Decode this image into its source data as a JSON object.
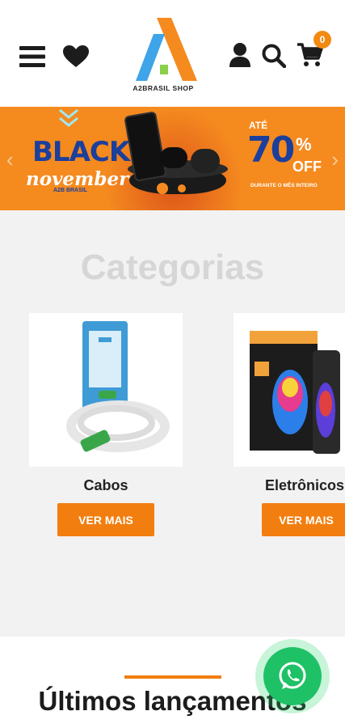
{
  "header": {
    "logo_text": "A2BRASIL SHOP",
    "cart_count": "0"
  },
  "banner": {
    "black": "BLACK",
    "november": "november",
    "brand": "A2B BRASIL",
    "ate": "ATÉ",
    "percent": "70",
    "percent_sign": "%",
    "off": "OFF",
    "durante": "DURANTE O MÊS INTEIRO"
  },
  "categories": {
    "title": "Categorias",
    "items": [
      {
        "label": "Cabos",
        "button": "VER MAIS"
      },
      {
        "label": "Eletrônicos",
        "button": "VER MAIS"
      }
    ]
  },
  "latest": {
    "title": "Últimos lançamentos"
  },
  "colors": {
    "accent": "#f27e0f",
    "banner_bg": "#f58a1f",
    "brand_blue": "#1b3f9c",
    "whatsapp": "#1fc166"
  },
  "icons": [
    "menu-icon",
    "heart-icon",
    "user-icon",
    "search-icon",
    "cart-icon",
    "whatsapp-icon",
    "chevron-left-icon",
    "chevron-right-icon"
  ]
}
